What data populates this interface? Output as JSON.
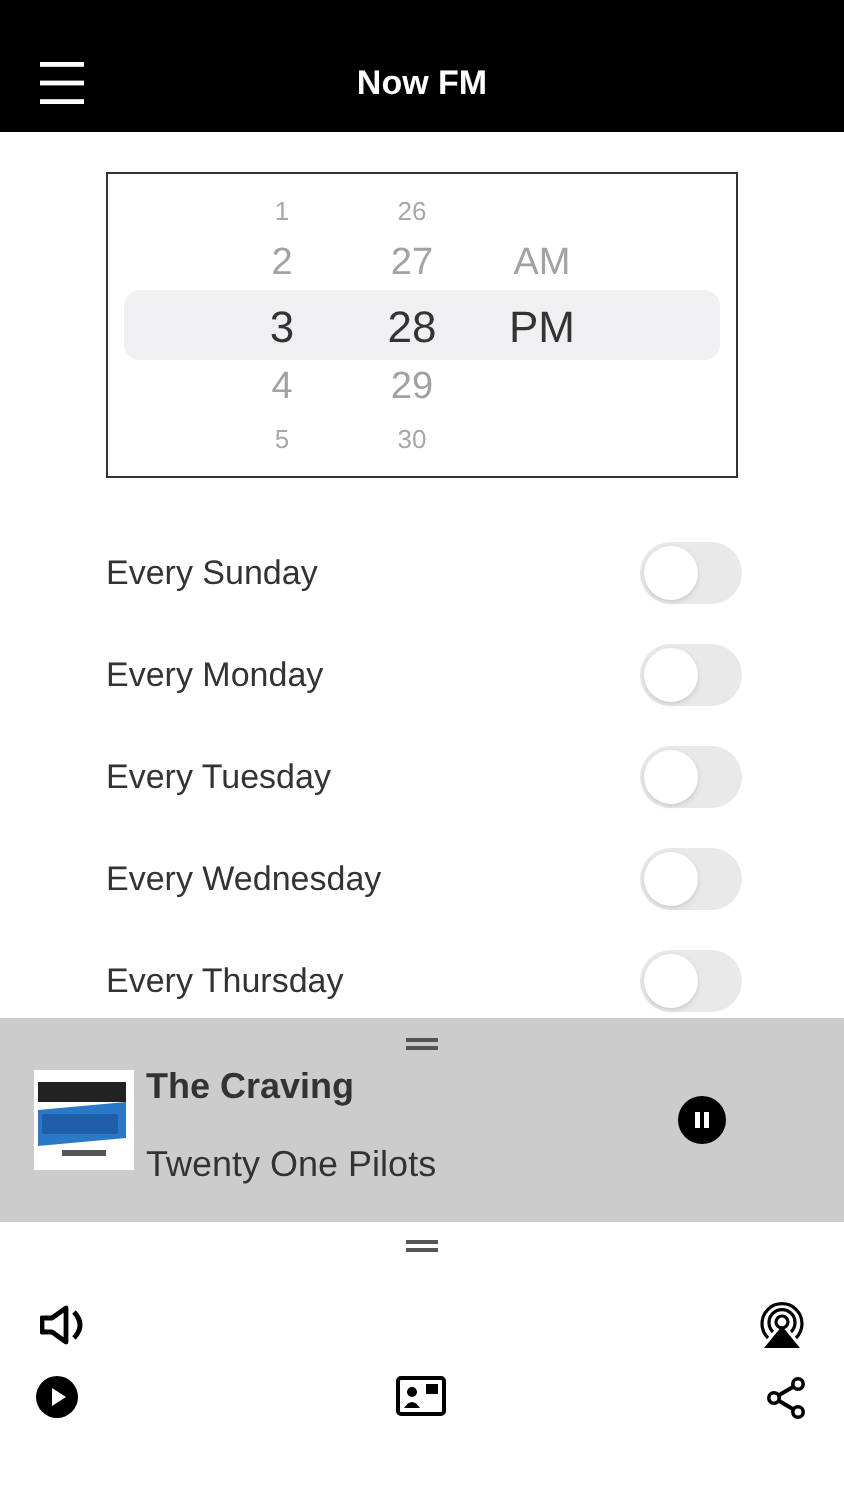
{
  "header": {
    "title": "Now FM"
  },
  "time_picker": {
    "columns": [
      {
        "items": [
          {
            "label": "1",
            "selected": false
          },
          {
            "label": "2",
            "selected": false
          },
          {
            "label": "3",
            "selected": true
          },
          {
            "label": "4",
            "selected": false
          },
          {
            "label": "5",
            "selected": false
          }
        ]
      },
      {
        "items": [
          {
            "label": "26",
            "selected": false
          },
          {
            "label": "27",
            "selected": false
          },
          {
            "label": "28",
            "selected": true
          },
          {
            "label": "29",
            "selected": false
          },
          {
            "label": "30",
            "selected": false
          }
        ]
      },
      {
        "items": [
          {
            "label": "AM",
            "selected": false
          },
          {
            "label": "PM",
            "selected": true
          }
        ]
      }
    ]
  },
  "days": [
    {
      "label": "Every Sunday",
      "on": false
    },
    {
      "label": "Every Monday",
      "on": false
    },
    {
      "label": "Every Tuesday",
      "on": false
    },
    {
      "label": "Every Wednesday",
      "on": false
    },
    {
      "label": "Every Thursday",
      "on": false
    }
  ],
  "mini_player": {
    "title": "The Craving",
    "artist": "Twenty One Pilots",
    "playing": true
  }
}
